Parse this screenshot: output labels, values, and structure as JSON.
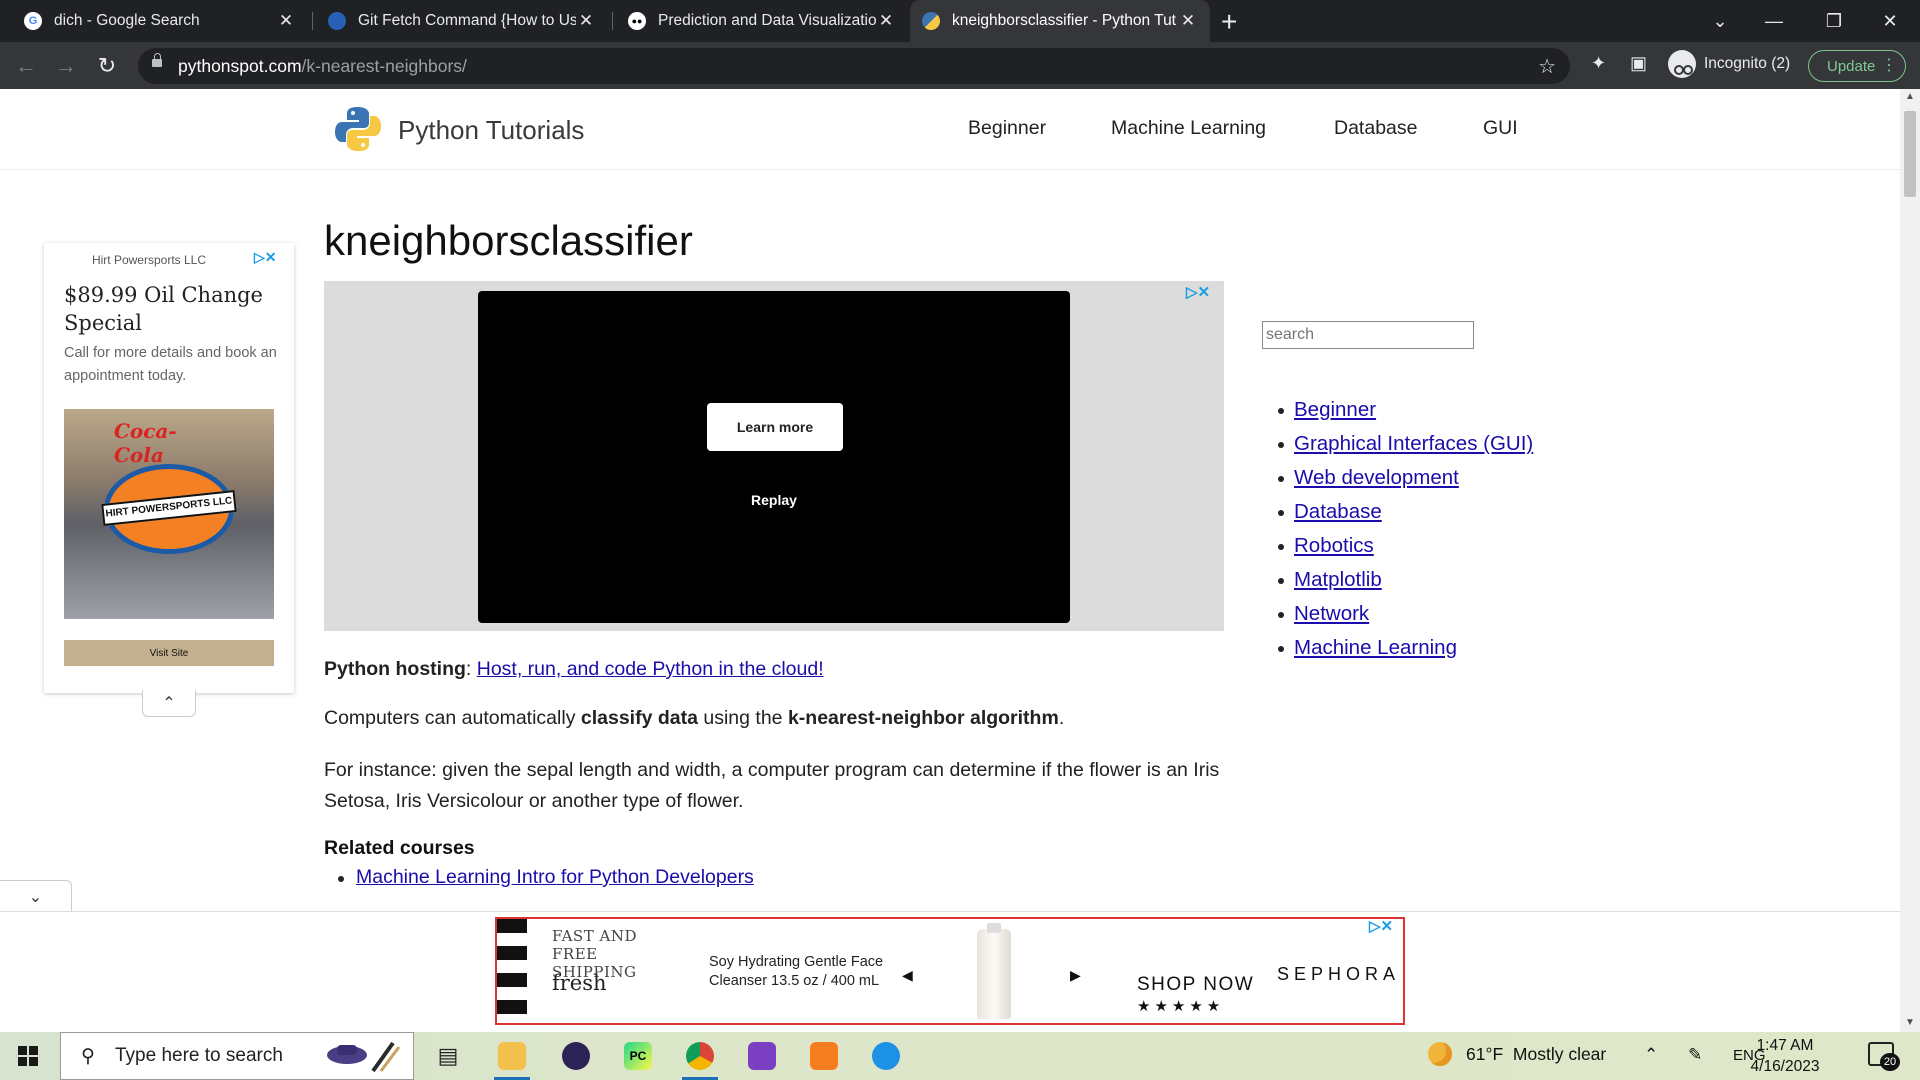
{
  "browser": {
    "tabs": [
      {
        "title": "dich - Google Search",
        "close": "✕"
      },
      {
        "title": "Git Fetch Command {How to Use",
        "close": "✕"
      },
      {
        "title": "Prediction and Data Visualization",
        "close": "✕"
      },
      {
        "title": "kneighborsclassifier - Python Tut",
        "close": "✕"
      }
    ],
    "new_tab": "+",
    "url_host": "pythonspot.com",
    "url_path": "/k-nearest-neighbors/",
    "profile_label": "Incognito (2)",
    "update_label": "Update",
    "icons": {
      "back": "←",
      "forward": "→",
      "reload": "↻",
      "star": "☆",
      "extensions": "✦",
      "sidepanel": "▣",
      "menu": "⋮",
      "tab_search": "⌄",
      "minimize": "—",
      "restore": "❐",
      "close": "✕"
    }
  },
  "site": {
    "brand": "Python Tutorials",
    "nav": [
      "Beginner",
      "Machine Learning",
      "Database",
      "GUI"
    ],
    "title": "kneighborsclassifier",
    "hosting_label": "Python hosting",
    "hosting_link": "Host, run, and code Python in the cloud!",
    "p1_a": "Computers can automatically ",
    "p1_b": "classify data",
    "p1_c": " using the ",
    "p1_d": "k-nearest-neighbor algorithm",
    "p1_e": ".",
    "p2": "For instance: given the sepal length and width, a computer program can determine if the flower is an Iris Setosa, Iris Versicolour or another type of flower.",
    "related_heading": "Related courses",
    "related": [
      "Machine Learning Intro for Python Developers"
    ],
    "search_placeholder": "search",
    "sidebar_links": [
      "Beginner",
      "Graphical Interfaces (GUI)",
      "Web development",
      "Database",
      "Robotics",
      "Matplotlib",
      "Network",
      "Machine Learning"
    ]
  },
  "ads": {
    "left": {
      "advertiser": "Hirt Powersports LLC",
      "headline": "$89.99 Oil Change Special",
      "desc": "Call for more details and book an appointment today.",
      "photo_text": "Coca-Cola",
      "photo_sign": "HIRT POWERSPORTS LLC",
      "cta": "Visit Site",
      "collapse": "⌃"
    },
    "video": {
      "learn_more": "Learn more",
      "replay": "Replay"
    },
    "bottom": {
      "promo": "FAST AND FREE SHIPPING",
      "brand_small": "fresh",
      "product": "Soy Hydrating Gentle Face Cleanser 13.5 oz / 400 mL",
      "shop_now": "SHOP NOW",
      "stars": "★★★★★",
      "brand": "SEPHORA",
      "expand": "⌄"
    },
    "adchoices": "▷✕"
  },
  "taskbar": {
    "search_placeholder": "Type here to search",
    "weather_temp": "61°F",
    "weather_desc": "Mostly clear",
    "lang": "ENG",
    "time": "1:47 AM",
    "date": "4/16/2023",
    "notifications": "20"
  }
}
